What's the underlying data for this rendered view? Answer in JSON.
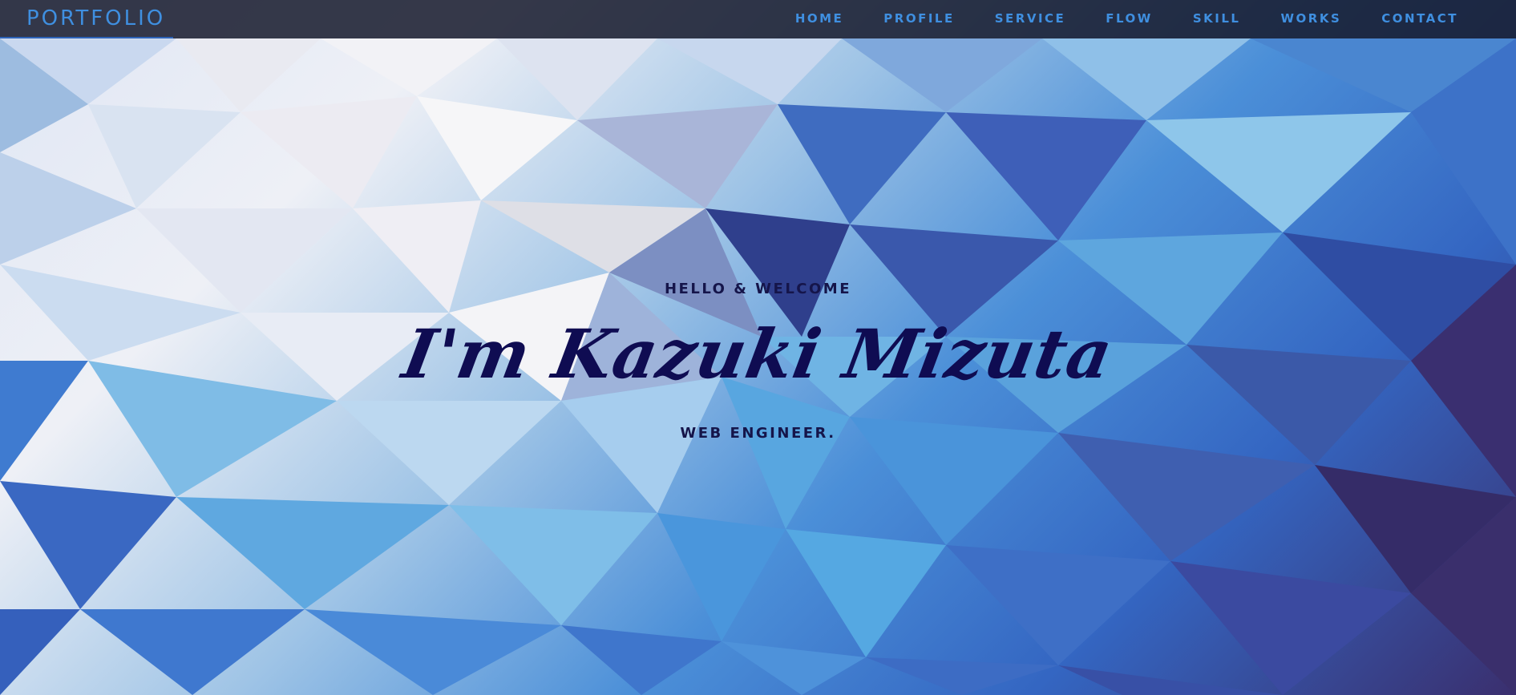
{
  "brand": {
    "label": "PORTFOLIO"
  },
  "nav": {
    "items": [
      {
        "label": "HOME"
      },
      {
        "label": "PROFILE"
      },
      {
        "label": "SERVICE"
      },
      {
        "label": "FLOW"
      },
      {
        "label": "SKILL"
      },
      {
        "label": "WORKS"
      },
      {
        "label": "CONTACT"
      }
    ]
  },
  "hero": {
    "greeting": "HELLO & WELCOME",
    "name": "I'm Kazuki Mizuta",
    "role": "WEB ENGINEER."
  },
  "colors": {
    "accent": "#3f8fe0",
    "navbar_bg": "#1a1e30",
    "heading_text": "#0f0c52"
  }
}
